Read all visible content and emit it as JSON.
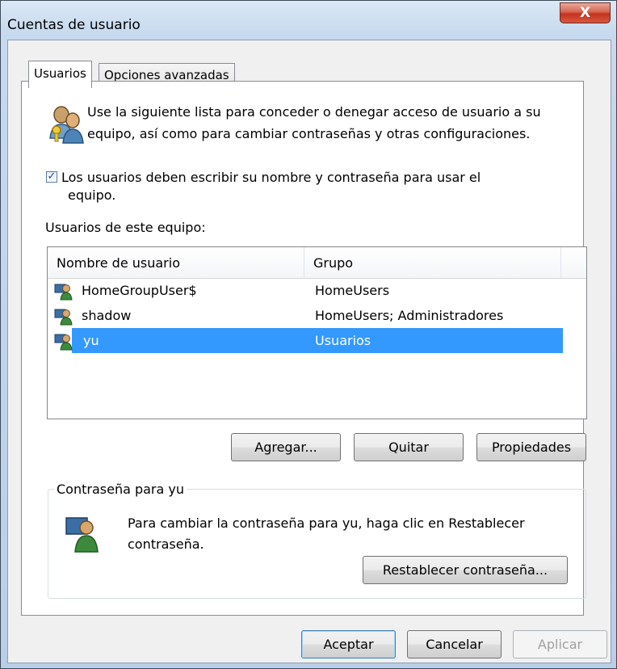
{
  "window": {
    "title": "Cuentas de usuario",
    "close_label": "X"
  },
  "tabs": [
    {
      "label": "Usuarios",
      "active": true
    },
    {
      "label": "Opciones avanzadas",
      "active": false
    }
  ],
  "intro": {
    "icon": "users-keys-icon",
    "text": "Use la siguiente lista para conceder o denegar acceso de usuario a su equipo, así como para cambiar contraseñas y otras configuraciones."
  },
  "require_login": {
    "checked": true,
    "label_line1": "Los usuarios deben escribir su nombre y contraseña para usar el",
    "label_line2": "equipo."
  },
  "users_list": {
    "label": "Usuarios de este equipo:",
    "columns": [
      "Nombre de usuario",
      "Grupo"
    ],
    "rows": [
      {
        "name": "HomeGroupUser$",
        "group": "HomeUsers",
        "selected": false
      },
      {
        "name": "shadow",
        "group": "HomeUsers; Administradores",
        "selected": false
      },
      {
        "name": "yu",
        "group": "Usuarios",
        "selected": true
      }
    ]
  },
  "list_buttons": {
    "add": "Agregar...",
    "remove": "Quitar",
    "properties": "Propiedades"
  },
  "password_group": {
    "title": "Contraseña para yu",
    "text": "Para cambiar la contraseña para yu, haga clic en Restablecer contraseña.",
    "reset_button": "Restablecer contraseña..."
  },
  "dialog_buttons": {
    "ok": "Aceptar",
    "cancel": "Cancelar",
    "apply": "Aplicar"
  },
  "colors": {
    "selection": "#3399ff",
    "title_bar": "#c6d9ee",
    "close_button": "#c4321d"
  }
}
